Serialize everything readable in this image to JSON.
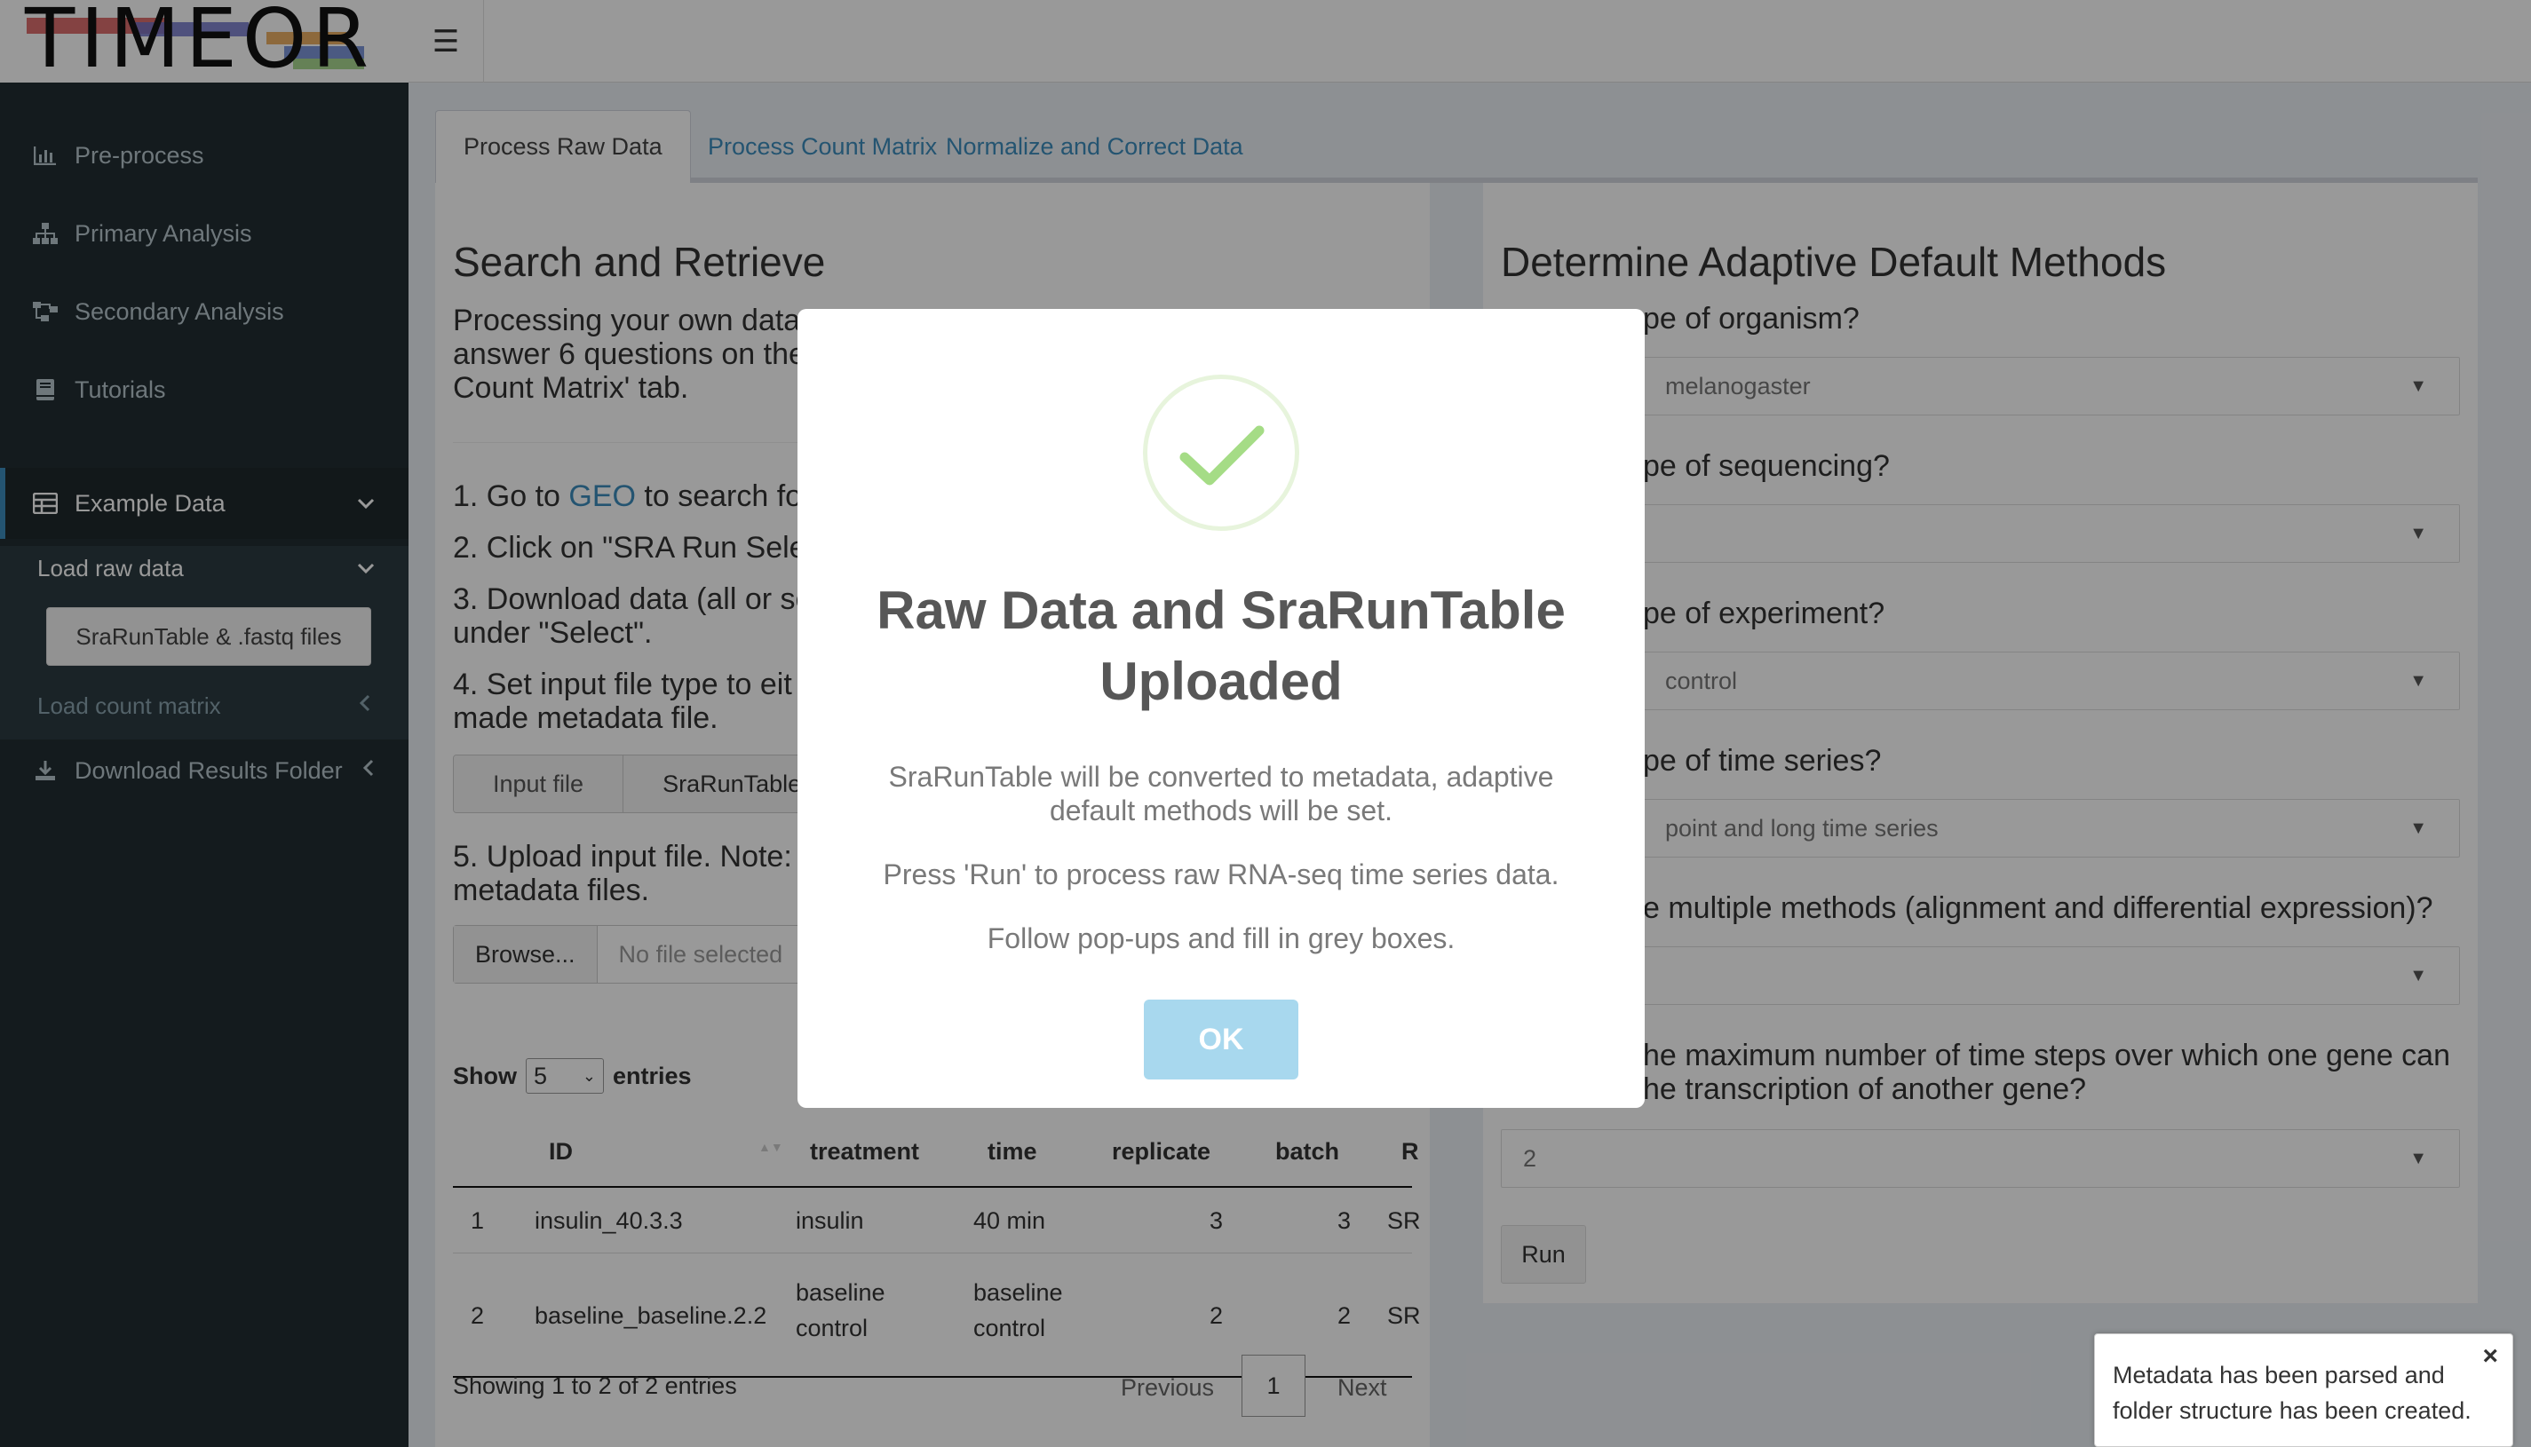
{
  "app": {
    "logo_text": "TIMEOR"
  },
  "header": {
    "toggle_icon": "hamburger-icon"
  },
  "sidebar": {
    "items": [
      {
        "label": "Pre-process",
        "icon": "bar-chart-icon"
      },
      {
        "label": "Primary Analysis",
        "icon": "sitemap-icon"
      },
      {
        "label": "Secondary Analysis",
        "icon": "network-icon"
      },
      {
        "label": "Tutorials",
        "icon": "book-icon"
      },
      {
        "label": "Example Data",
        "icon": "table-icon"
      },
      {
        "label": "Download Results Folder",
        "icon": "download-icon"
      }
    ],
    "sub": {
      "load_raw": "Load raw data",
      "raw_button": "SraRunTable & .fastq files",
      "load_count": "Load count matrix"
    }
  },
  "tabs": [
    "Process Raw Data",
    "Process Count Matrix",
    "Normalize and Correct Data"
  ],
  "left_panel": {
    "title": "Search and Retrieve",
    "intro_lines": [
      "Processing your own data",
      "answer 6 questions on the",
      "Count Matrix' tab."
    ],
    "step1_prefix": "1. Go to ",
    "step1_link": "GEO",
    "step1_suffix": " to search for",
    "step2": "2. Click on \"SRA Run Selec",
    "step3_a": "3. Download data (all or se",
    "step3_b": "under \"Select\".",
    "step4_a": "4. Set input file type to eit",
    "step4_b": "made metadata file.",
    "radio_options": [
      "Input file",
      "SraRunTable"
    ],
    "step5_a": "5. Upload input file. Note:",
    "step5_b": "metadata files.",
    "browse_label": "Browse...",
    "file_placeholder": "No file selected",
    "show_label": "Show",
    "show_value": "5",
    "entries_label": "entries",
    "table": {
      "headers": [
        "ID",
        "treatment",
        "time",
        "replicate",
        "batch",
        "R"
      ],
      "rows": [
        [
          "1",
          "insulin_40.3.3",
          "insulin",
          "40 min",
          "3",
          "3",
          "SR"
        ],
        [
          "2",
          "baseline_baseline.2.2",
          "baseline control",
          "baseline control",
          "2",
          "2",
          "SR"
        ]
      ]
    },
    "info": "Showing 1 to 2 of 2 entries",
    "pager": {
      "previous": "Previous",
      "current": "1",
      "next": "Next"
    }
  },
  "right_panel": {
    "title": "Determine Adaptive Default Methods",
    "questions": [
      {
        "q": "pe of organism?",
        "value": "melanogaster"
      },
      {
        "q": "pe of sequencing?",
        "value": ""
      },
      {
        "q": "pe of experiment?",
        "value": "control"
      },
      {
        "q": "pe of time series?",
        "value": "point and long time series"
      },
      {
        "q": "e multiple methods (alignment and differential expression)?",
        "value": ""
      }
    ],
    "q6_a": "he maximum number of time steps over which one gene can",
    "q6_b": "he transcription of another gene?",
    "q6_value": "2",
    "run_label": "Run"
  },
  "modal": {
    "icon": "checkmark-icon",
    "title": "Raw Data and SraRunTable Uploaded",
    "line1": "SraRunTable will be converted to metadata, adaptive default methods will be set.",
    "line2": "Press 'Run' to process raw RNA-seq time series data.",
    "line3": "Follow pop-ups and fill in grey boxes.",
    "ok_label": "OK"
  },
  "notification": {
    "message": "Metadata has been parsed and folder structure has been created.",
    "close": "×"
  },
  "colors": {
    "accent": "#3c8dbc",
    "sidebar": "#222d32",
    "ok_button": "#a8d8ee",
    "check": "#a5dc86"
  }
}
